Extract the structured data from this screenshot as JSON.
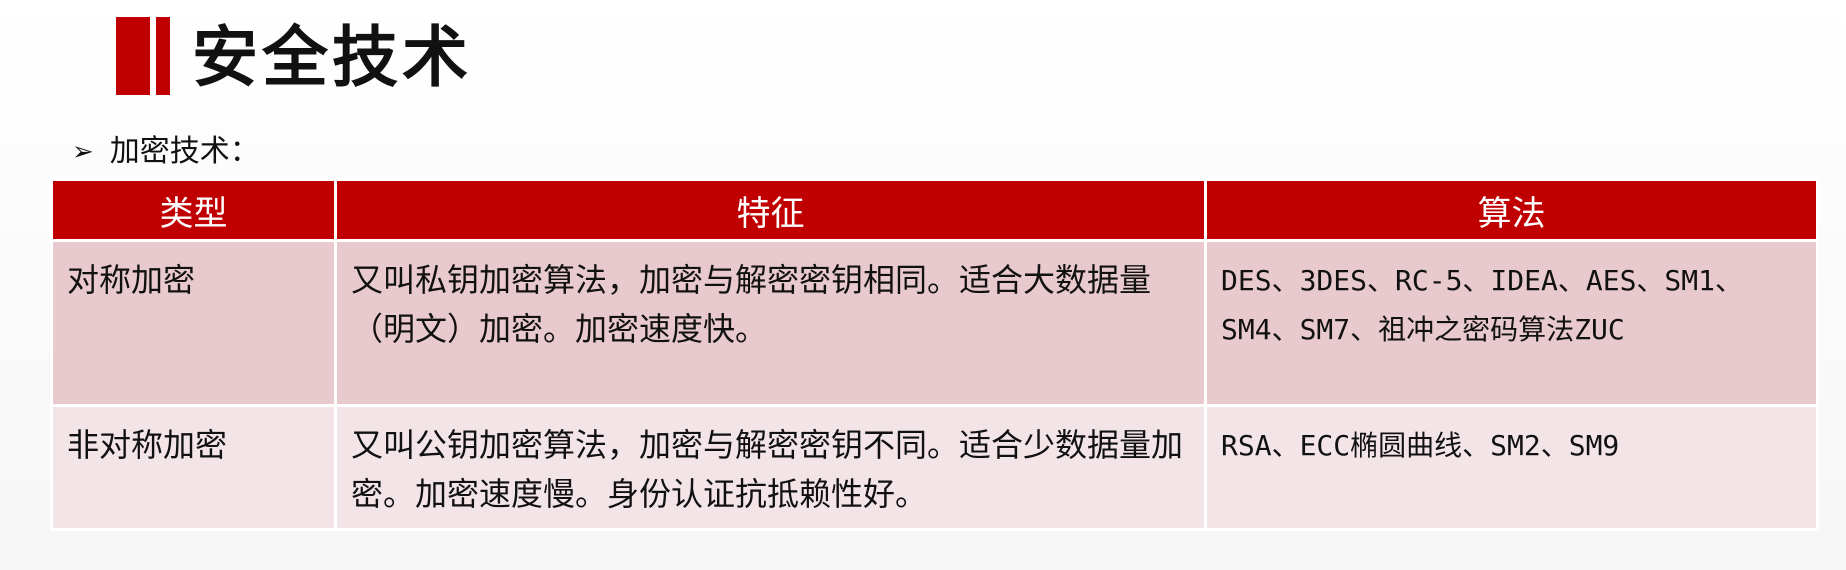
{
  "slide": {
    "title": "安全技术",
    "bullet": "加密技术：",
    "bullet_icon": "arrow-bullet-icon",
    "accent_color": "#c00000"
  },
  "table": {
    "headers": [
      "类型",
      "特征",
      "算法"
    ],
    "rows": [
      {
        "type": "对称加密",
        "features": "又叫私钥加密算法，加密与解密密钥相同。适合大数据量（明文）加密。加密速度快。",
        "algorithms_line1": "DES、3DES、RC-5、IDEA、AES、SM1、",
        "algorithms_line2": "SM4、SM7、祖冲之密码算法ZUC"
      },
      {
        "type": "非对称加密",
        "features": "又叫公钥加密算法，加密与解密密钥不同。适合少数据量加密。加密速度慢。身份认证抗抵赖性好。",
        "algorithms_line1": "RSA、ECC椭圆曲线、SM2、SM9",
        "algorithms_line2": ""
      }
    ]
  }
}
